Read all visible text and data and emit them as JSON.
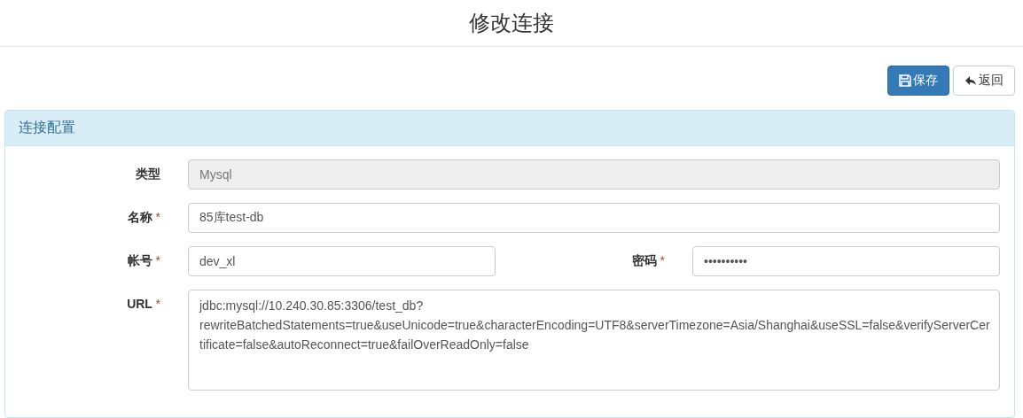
{
  "page": {
    "title": "修改连接"
  },
  "toolbar": {
    "buttons": [
      {
        "label": "保存",
        "kind": "primary"
      },
      {
        "label": "返回",
        "kind": "default"
      }
    ]
  },
  "panel": {
    "title": "连接配置",
    "rows": [
      {
        "fields": [
          {
            "label": "类型",
            "value": "Mysql",
            "disabled": true,
            "kind": "input"
          }
        ]
      },
      {
        "fields": [
          {
            "label": "名称",
            "required_mark": "*",
            "value": "85库test-db",
            "disabled": false,
            "kind": "input"
          }
        ]
      },
      {
        "fields": [
          {
            "label": "帐号",
            "required_mark": "*",
            "value": "dev_xl",
            "disabled": false,
            "kind": "input"
          },
          {
            "label": "密码",
            "required_mark": "*",
            "value": "••••••••••",
            "disabled": false,
            "kind": "input"
          }
        ]
      },
      {
        "fields": [
          {
            "label": "URL",
            "required_mark": "*",
            "value": "jdbc:mysql://10.240.30.85:3306/test_db?rewriteBatchedStatements=true&useUnicode=true&characterEncoding=UTF8&serverTimezone=Asia/Shanghai&useSSL=false&verifyServerCertificate=false&autoReconnect=true&failOverReadOnly=false",
            "disabled": false,
            "kind": "textarea"
          }
        ]
      }
    ]
  }
}
